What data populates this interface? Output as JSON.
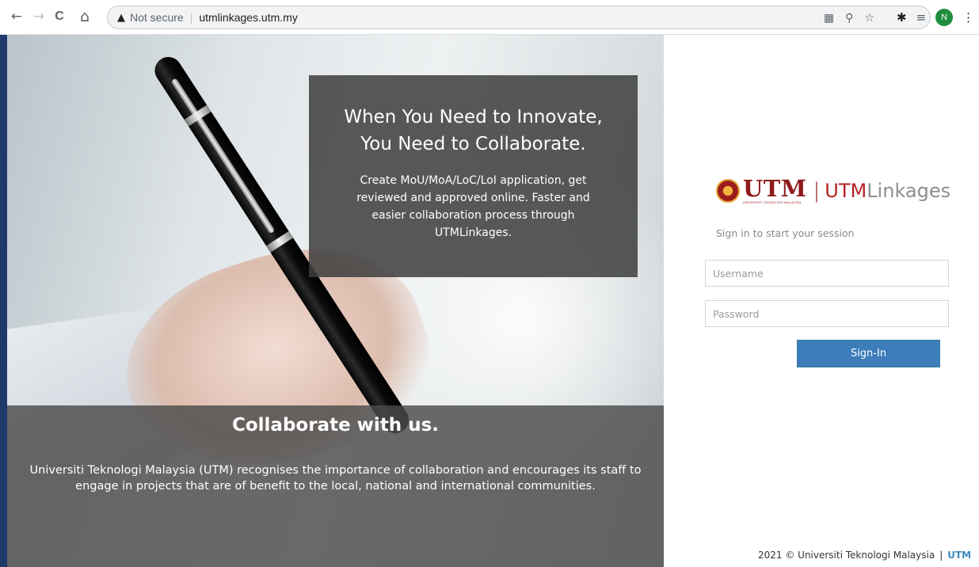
{
  "browser": {
    "back_icon": "←",
    "forward_icon": "→",
    "reload_icon": "C",
    "home_icon": "⌂",
    "security_icon": "▲",
    "security_label": "Not secure",
    "separator": "|",
    "url": "utmlinkages.utm.my",
    "qr_icon": "▦",
    "zoom_icon": "⚲",
    "star_icon": "☆",
    "extensions_icon": "✱",
    "reading_list_icon": "≡",
    "profile_initial": "N",
    "menu_icon": "⋮"
  },
  "hero": {
    "headline": "When You Need to Innovate,\nYou Need to Collaborate.",
    "description": "Create MoU/MoA/LoC/LoI application, get reviewed and approved online. Faster and easier collaboration process through UTMLinkages.",
    "collab_title": "Collaborate with us.",
    "collab_text": "Universiti Teknologi Malaysia (UTM) recognises the importance of collaboration and encourages its staff to engage in projects that are of benefit to the local, national and international communities."
  },
  "login": {
    "logo_text": "UTM",
    "logo_subtext": "UNIVERSITI TEKNOLOGI MALAYSIA",
    "brand_separator": "|",
    "brand_accent": "UTM",
    "brand_rest": "Linkages",
    "message": "Sign in to start your session",
    "username_placeholder": "Username",
    "password_placeholder": "Password",
    "signin_label": "Sign-In"
  },
  "footer": {
    "copyright": "2021 © Universiti Teknologi Malaysia",
    "separator": "|",
    "link": "UTM"
  },
  "colors": {
    "brand_red": "#8e1a1d",
    "button_blue": "#3c7dba",
    "link_blue": "#3c8dbc"
  }
}
